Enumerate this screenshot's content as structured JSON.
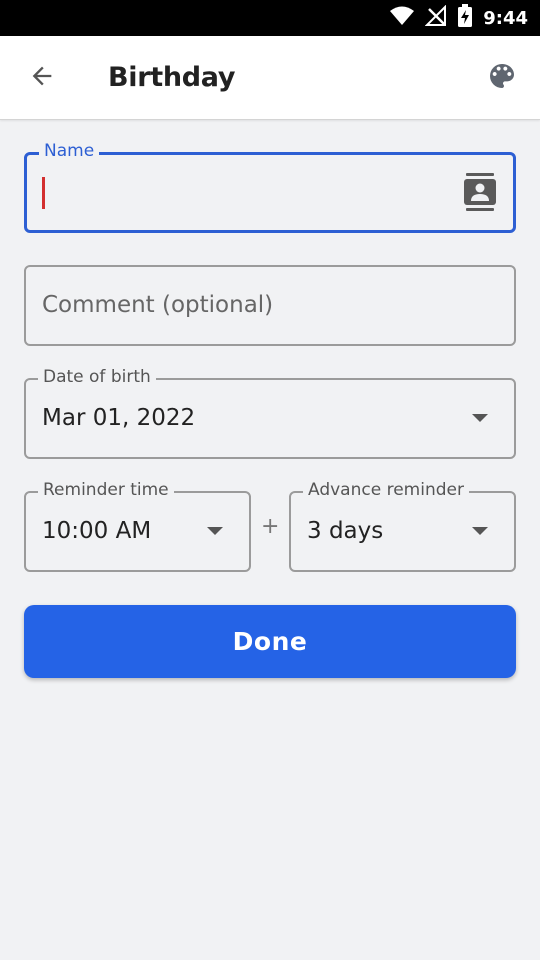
{
  "status_bar": {
    "time": "9:44",
    "icons": [
      "wifi-icon",
      "no-signal-icon",
      "battery-charging-icon"
    ]
  },
  "app_bar": {
    "title": "Birthday",
    "back_icon": "arrow-back-icon",
    "palette_icon": "palette-icon"
  },
  "form": {
    "name": {
      "label": "Name",
      "value": "",
      "contact_icon": "contact-book-icon"
    },
    "comment": {
      "placeholder": "Comment (optional)"
    },
    "date_of_birth": {
      "label": "Date of birth",
      "value": "Mar 01, 2022"
    },
    "reminder_time": {
      "label": "Reminder time",
      "value": "10:00 AM"
    },
    "plus": "+",
    "advance_reminder": {
      "label": "Advance reminder",
      "value": "3 days"
    },
    "done_label": "Done"
  },
  "colors": {
    "accent": "#2563e6",
    "focus_border": "#2d5fd3",
    "caret": "#d32f2f",
    "background": "#f1f2f4"
  }
}
